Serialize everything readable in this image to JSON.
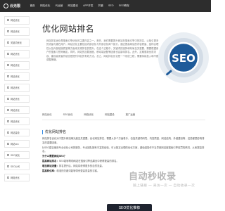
{
  "header": {
    "logo_text": "云无限",
    "nav": [
      "首页",
      "网站优化",
      "代运营",
      "网站建设",
      "APP开发",
      "托管",
      "SEO",
      "SEO教程"
    ]
  },
  "sidebar": {
    "items": [
      "网站优化",
      "网站优化",
      "关键词优化",
      "网站优化",
      "网站优化",
      "网站优化",
      "网站优化",
      "网站优化",
      "网站优化",
      "网站优化",
      "网站建设",
      "网站seo",
      "SEO优化",
      "SEO公司",
      "网络优化"
    ]
  },
  "hero": {
    "title": "优化网站排名",
    "description": "网站排名优化是搜索引擎优化的主要内容之一。首先，我们需要提升网站在搜索引擎中的排名，以吸引更多的流量与潜在用户。网站优化主要包括内部优化与外部优化两个部分，通过提高网站的内容质量、结构合理性以及外部链接质量等方面来实现排名的提升。在这个过程中，关键词的选择和布局至关重要，需要根据用户的搜索习惯来确定。同时，网站的加载速度、移动端适配等因素也会影响排名。此外，定期更新优质内容、建设高质量外链也是提升排名的有效方法。总之，网站排名优化是一个系统工程，需要持续投入和不断调整策略。",
    "art_label": "SEO"
  },
  "links_row1": [
    "网站优化",
    "SEO优化",
    "网络优化",
    "网站建设",
    "推广运营"
  ],
  "links_row2": [
    "网站优化",
    "网站优化",
    "关键词排名",
    "网站优化",
    "SEO优化",
    "站内优化",
    "网站优化",
    "百度推广运营"
  ],
  "article": {
    "title": "优化网站排名",
    "paragraphs": [
      {
        "strong": "",
        "text": "网站排名优化对于提升网站曝光度至关重要。优化网站排名，需要从多个方面着手，包括关键词研究、内容质量、网站结构、外链建设等，这些都是影响排名的重要因素。"
      },
      {
        "strong": "1.",
        "text": "SEO建议使用专业优化公司的服务，专业团队拥有丰富的经验，可以制定合理的优化方案，避免因操作不当导致网站被搜索引擎惩罚的情况，从而提高排名。"
      },
      {
        "strong": "为什么需要网站SEO？",
        "text": ""
      },
      {
        "strong": "提高网站排名：",
        "text": "SEO能够帮助网站在搜索引擎结果页中获得更高的排名。"
      },
      {
        "strong": "增加网站流量：",
        "text": "排名提升后，网站将获得更多的自然流量。"
      },
      {
        "strong": "提高转化率：",
        "text": "精准的关键词能够带来更高质量的访客。"
      }
    ]
  },
  "watermark": {
    "main": "自动秒收录",
    "sub": "随上链接 一 来访一次 一 自动收录一次"
  },
  "badge": {
    "text": "SEO优化推荐"
  }
}
